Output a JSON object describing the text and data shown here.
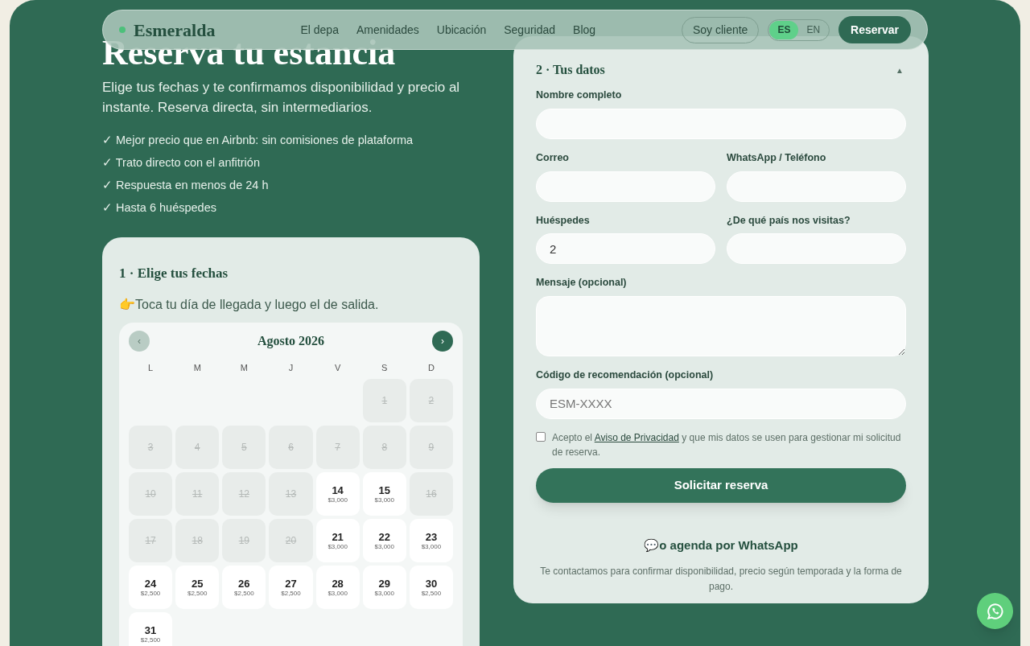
{
  "nav": {
    "brand": "Esmeralda",
    "links": [
      "El depa",
      "Amenidades",
      "Ubicación",
      "Seguridad",
      "Blog"
    ],
    "client_button": "Soy cliente",
    "languages": [
      {
        "label": "ES",
        "selected": true
      },
      {
        "label": "EN",
        "selected": false
      }
    ],
    "cta": "Reservar"
  },
  "hero": {
    "title": "Reserva tu estancia",
    "subtitle": "Elige tus fechas y te confirmamos disponibilidad y precio al instante. Reserva directa, sin intermediarios.",
    "benefits": [
      "✓ Mejor precio que en Airbnb: sin comisiones de plataforma",
      "✓ Trato directo con el anfitrión",
      "✓ Respuesta en menos de 24 h",
      "✓ Hasta 6 huéspedes"
    ]
  },
  "dates_card": {
    "title": "1 · Elige tus fechas",
    "hint": "👉Toca tu día de llegada y luego el de salida.",
    "calendar": {
      "prev": "‹",
      "prev_disabled": true,
      "month": "Agosto 2026",
      "next": "›",
      "weekdays": [
        "L",
        "M",
        "M",
        "J",
        "V",
        "S",
        "D"
      ],
      "days": [
        {
          "day": "1",
          "kind": "blocked"
        },
        {
          "day": "2",
          "kind": "blocked"
        },
        {
          "day": "3",
          "kind": "blocked"
        },
        {
          "day": "4",
          "kind": "blocked"
        },
        {
          "day": "5",
          "kind": "blocked"
        },
        {
          "day": "6",
          "kind": "blocked"
        },
        {
          "day": "7",
          "kind": "blocked"
        },
        {
          "day": "8",
          "kind": "blocked"
        },
        {
          "day": "9",
          "kind": "blocked"
        },
        {
          "day": "10",
          "kind": "blocked"
        },
        {
          "day": "11",
          "kind": "blocked"
        },
        {
          "day": "12",
          "kind": "blocked"
        },
        {
          "day": "13",
          "kind": "blocked"
        },
        {
          "day": "14",
          "kind": "available",
          "price": "$3,000"
        },
        {
          "day": "15",
          "kind": "available",
          "price": "$3,000"
        },
        {
          "day": "16",
          "kind": "blocked"
        },
        {
          "day": "17",
          "kind": "blocked"
        },
        {
          "day": "18",
          "kind": "blocked"
        },
        {
          "day": "19",
          "kind": "blocked"
        },
        {
          "day": "20",
          "kind": "blocked"
        },
        {
          "day": "21",
          "kind": "available",
          "price": "$3,000"
        },
        {
          "day": "22",
          "kind": "available",
          "price": "$3,000"
        },
        {
          "day": "23",
          "kind": "available",
          "price": "$3,000"
        },
        {
          "day": "24",
          "kind": "available",
          "price": "$2,500"
        },
        {
          "day": "25",
          "kind": "available",
          "price": "$2,500"
        },
        {
          "day": "26",
          "kind": "available",
          "price": "$2,500"
        },
        {
          "day": "27",
          "kind": "available",
          "price": "$2,500"
        },
        {
          "day": "28",
          "kind": "available",
          "price": "$3,000"
        },
        {
          "day": "29",
          "kind": "available",
          "price": "$3,000"
        },
        {
          "day": "30",
          "kind": "available",
          "price": "$2,500"
        },
        {
          "day": "31",
          "kind": "available",
          "price": "$2,500"
        }
      ]
    }
  },
  "details_card": {
    "title": "2 · Tus datos",
    "toggle": "▲",
    "expanded": true,
    "field_rows": [
      [
        {
          "label": "Nombre completo",
          "kind": "text"
        }
      ],
      [
        {
          "label": "Correo",
          "kind": "text"
        },
        {
          "label": "WhatsApp / Teléfono",
          "kind": "text"
        }
      ],
      [
        {
          "label": "Huéspedes",
          "kind": "text",
          "value": "2"
        },
        {
          "label": "¿De qué país nos visitas?",
          "kind": "text"
        }
      ],
      [
        {
          "label": "Mensaje (opcional)",
          "kind": "textarea"
        }
      ],
      [
        {
          "label": "Código de recomendación (opcional)",
          "kind": "text",
          "placeholder": "ESM-XXXX"
        }
      ]
    ],
    "consent": {
      "checked": false,
      "before": "Acepto el ",
      "link": "Aviso de Privacidad",
      "after": " y que mis datos se usen para gestionar mi solicitud de reserva."
    },
    "submit": "Solicitar reserva",
    "whatsapp_title": "💬o agenda por WhatsApp",
    "note": "Te contactamos para confirmar disponibilidad, precio según temporada y la forma de pago."
  }
}
